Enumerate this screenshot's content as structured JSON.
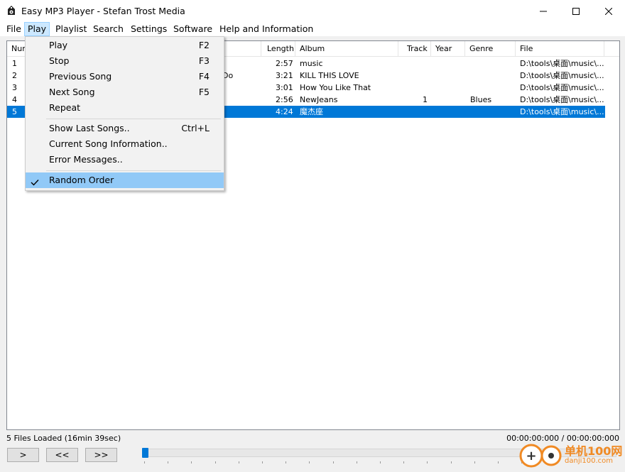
{
  "window": {
    "title": "Easy MP3 Player - Stefan Trost Media",
    "icon": "speaker-player-icon"
  },
  "menubar": [
    "File",
    "Play",
    "Playlist",
    "Search",
    "Settings",
    "Software",
    "Help and Information"
  ],
  "columns": [
    "Num",
    "Length",
    "Album",
    "Track",
    "Year",
    "Genre",
    "File"
  ],
  "rows": [
    {
      "num": "1",
      "title_tail": "",
      "length": "2:57",
      "album": "music",
      "track": "",
      "year": "",
      "genre": "",
      "file": "D:\\tools\\桌面\\music\\..."
    },
    {
      "num": "2",
      "title_tail": "Do",
      "length": "3:21",
      "album": "KILL THIS LOVE",
      "track": "",
      "year": "",
      "genre": "",
      "file": "D:\\tools\\桌面\\music\\..."
    },
    {
      "num": "3",
      "title_tail": "",
      "length": "3:01",
      "album": "How You Like That",
      "track": "",
      "year": "",
      "genre": "",
      "file": "D:\\tools\\桌面\\music\\..."
    },
    {
      "num": "4",
      "title_tail": "",
      "length": "2:56",
      "album": "NewJeans",
      "track": "1",
      "year": "",
      "genre": "Blues",
      "file": "D:\\tools\\桌面\\music\\..."
    },
    {
      "num": "5",
      "title_tail": "",
      "length": "4:24",
      "album": "魔杰座",
      "track": "",
      "year": "",
      "genre": "",
      "file": "D:\\tools\\桌面\\music\\..."
    }
  ],
  "selected_row": 5,
  "play_menu": {
    "items": [
      {
        "label": "Play",
        "shortcut": "F2"
      },
      {
        "label": "Stop",
        "shortcut": "F3"
      },
      {
        "label": "Previous Song",
        "shortcut": "F4"
      },
      {
        "label": "Next Song",
        "shortcut": "F5"
      },
      {
        "label": "Repeat",
        "shortcut": ""
      },
      {
        "label": "Show Last Songs..",
        "shortcut": "Ctrl+L"
      },
      {
        "label": "Current Song Information..",
        "shortcut": ""
      },
      {
        "label": "Error Messages..",
        "shortcut": ""
      },
      {
        "label": "Random Order",
        "shortcut": "",
        "checked": true
      }
    ]
  },
  "status": {
    "files_loaded": "5 Files Loaded (16min 39sec)",
    "time": "00:00:00:000  /  00:00:00:000"
  },
  "controls": {
    "play": ">",
    "prev": "<<",
    "next": ">>"
  },
  "seek": {
    "position": 0
  },
  "watermark": {
    "line1": "单机100网",
    "line2": "danji100.com"
  },
  "colors": {
    "selection": "#0078d7",
    "menu_active": "#cce8ff",
    "menu_checked": "#91c9f7",
    "watermark": "#f08a24"
  }
}
